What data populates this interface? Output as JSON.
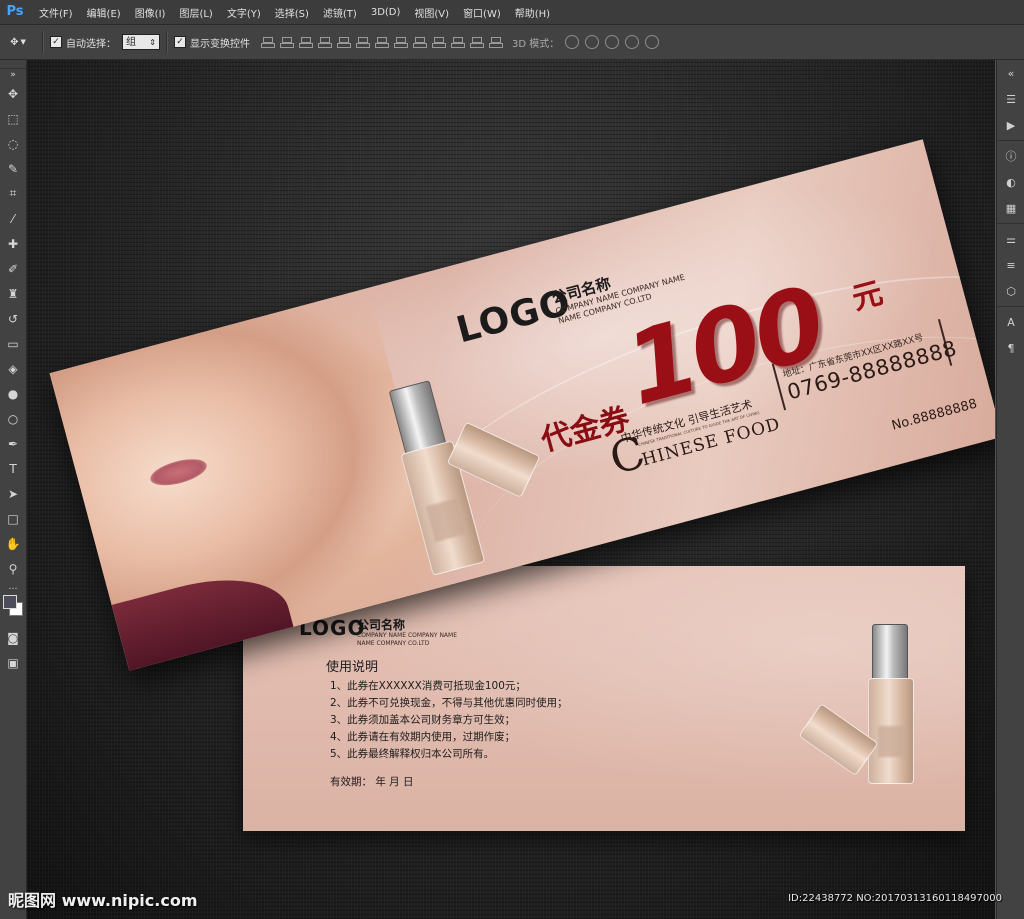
{
  "app": {
    "logo": "Ps",
    "menu": [
      "文件(F)",
      "编辑(E)",
      "图像(I)",
      "图层(L)",
      "文字(Y)",
      "选择(S)",
      "滤镜(T)",
      "3D(D)",
      "视图(V)",
      "窗口(W)",
      "帮助(H)"
    ]
  },
  "options": {
    "auto_select_label": "自动选择：",
    "auto_select_value": "组",
    "show_transform_label": "显示变换控件",
    "mode_3d_label": "3D 模式："
  },
  "front": {
    "logo": "LOGO",
    "company": "公司名称",
    "company_en1": "COMPANY NAME COMPANY NAME",
    "company_en2": "NAME COMPANY CO.LTD",
    "title": "代金券",
    "amount": "100",
    "unit": "元",
    "slogan": "中华传统文化 引导生活艺术",
    "slogan_sub": "CHINESE TRADITIONAL CULTURE TO GUIDE THE ART OF LIVING",
    "brand_initial": "C",
    "brand_rest": "HINESE FOOD",
    "address": "地址：广东省东莞市XX区XX路XX号",
    "phone": "0769-88888888",
    "serial": "No.88888888"
  },
  "back": {
    "logo": "LOGO",
    "company": "公司名称",
    "company_en1": "COMPANY NAME COMPANY NAME",
    "company_en2": "NAME COMPANY CO.LTD",
    "title": "使用说明",
    "rules": [
      "1、此券在XXXXXX消费可抵现金100元；",
      "2、此券不可兑换现金，不得与其他优惠同时使用；",
      "3、此券须加盖本公司财务章方可生效；",
      "4、此券请在有效期内使用，过期作废；",
      "5、此券最终解释权归本公司所有。"
    ],
    "validity": "有效期：      年    月    日"
  },
  "watermark": {
    "left": "昵图网 www.nipic.com",
    "right": "ID:22438772 NO:20170313160118497000"
  },
  "colors": {
    "accent_red": "#9a0e16",
    "voucher_pink": "#e2bcae",
    "ps_blue": "#4aa3ff"
  }
}
